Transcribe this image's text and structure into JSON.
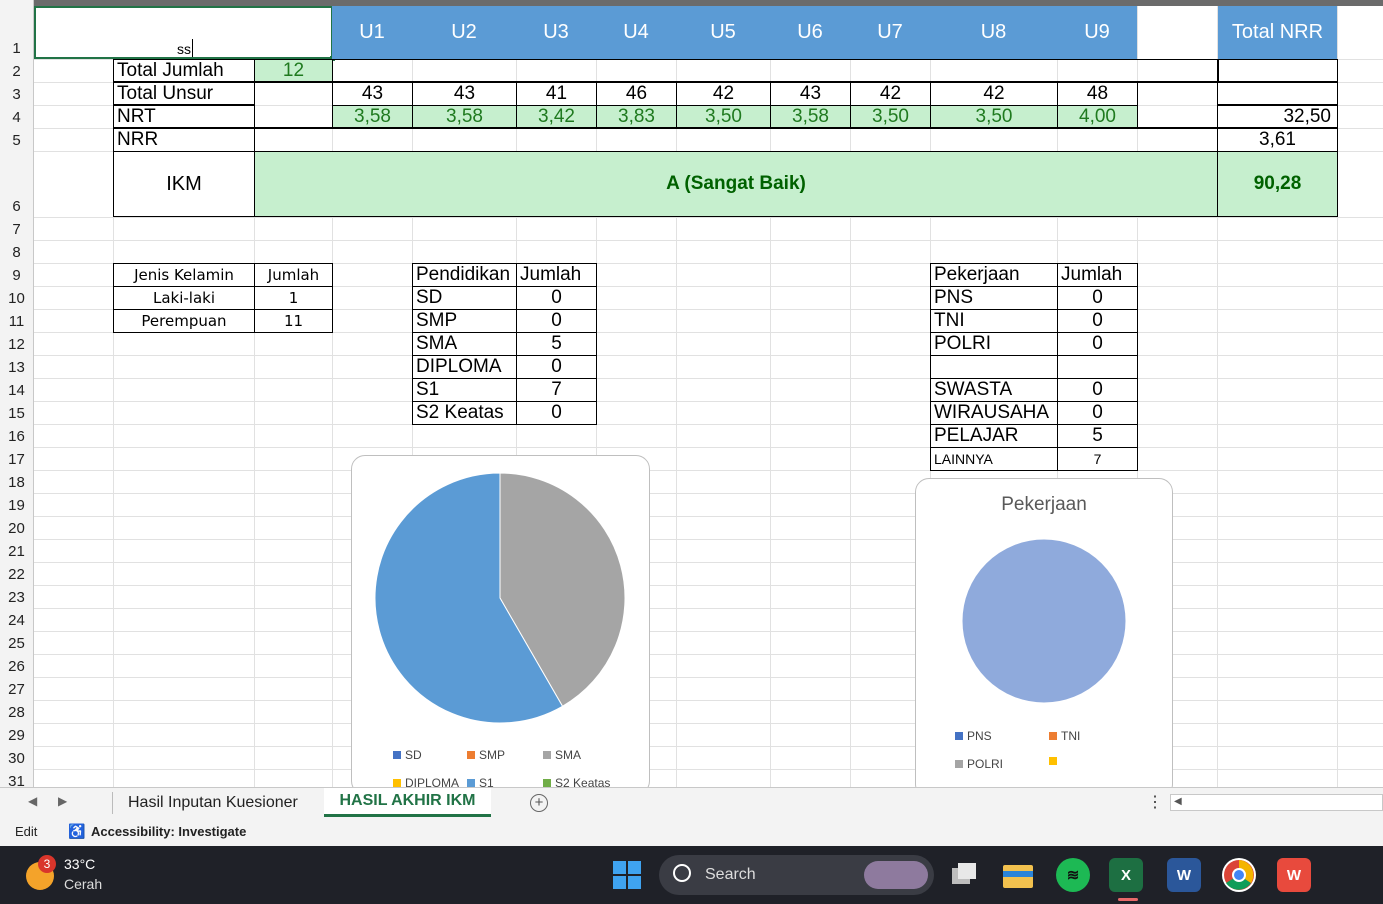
{
  "sheet": {
    "row_numbers": [
      "1",
      "2",
      "3",
      "4",
      "5",
      "6",
      "7",
      "8",
      "9",
      "10",
      "11",
      "12",
      "13",
      "14",
      "15",
      "16",
      "17",
      "18",
      "19",
      "20",
      "21",
      "22",
      "23",
      "24",
      "25",
      "26",
      "27",
      "28",
      "29",
      "30",
      "31"
    ],
    "active_cell_text": "ss",
    "unsur_headers": [
      "U1",
      "U2",
      "U3",
      "U4",
      "U5",
      "U6",
      "U7",
      "U8",
      "U9"
    ],
    "total_nrr_header": "Total NRR",
    "total_jumlah_label": "Total Jumlah",
    "total_jumlah_value": "12",
    "total_unsur_label": "Total Unsur",
    "total_unsur_values": [
      "43",
      "43",
      "41",
      "46",
      "42",
      "43",
      "42",
      "42",
      "48"
    ],
    "nrt_label": "NRT",
    "nrt_values": [
      "3,58",
      "3,58",
      "3,42",
      "3,83",
      "3,50",
      "3,58",
      "3,50",
      "3,50",
      "4,00"
    ],
    "nrt_total": "32,50",
    "nrr_label": "NRR",
    "nrr_total": "3,61",
    "ikm_label": "IKM",
    "ikm_grade": "A (Sangat Baik)",
    "ikm_value": "90,28",
    "gender_table": {
      "headers": [
        "Jenis Kelamin",
        "Jumlah"
      ],
      "rows": [
        [
          "Laki-laki",
          "1"
        ],
        [
          "Perempuan",
          "11"
        ]
      ]
    },
    "education_table": {
      "headers": [
        "Pendidikan",
        "Jumlah"
      ],
      "rows": [
        [
          "SD",
          "0"
        ],
        [
          "SMP",
          "0"
        ],
        [
          "SMA",
          "5"
        ],
        [
          "DIPLOMA",
          "0"
        ],
        [
          "S1",
          "7"
        ],
        [
          "S2 Keatas",
          "0"
        ]
      ]
    },
    "job_table": {
      "headers": [
        "Pekerjaan",
        "Jumlah"
      ],
      "rows": [
        [
          "PNS",
          "0"
        ],
        [
          "TNI",
          "0"
        ],
        [
          "POLRI",
          "0"
        ],
        [
          "",
          ""
        ],
        [
          "SWASTA",
          "0"
        ],
        [
          "WIRAUSAHA",
          "0"
        ],
        [
          "PELAJAR",
          "5"
        ],
        [
          "LAINNYA",
          "7"
        ]
      ]
    }
  },
  "chart_data": [
    {
      "type": "pie",
      "title": "",
      "categories": [
        "SD",
        "SMP",
        "SMA",
        "DIPLOMA",
        "S1",
        "S2 Keatas"
      ],
      "values": [
        0,
        0,
        5,
        0,
        7,
        0
      ],
      "colors": [
        "#4472c4",
        "#ed7d31",
        "#a5a5a5",
        "#ffc000",
        "#5b9bd5",
        "#70ad47"
      ]
    },
    {
      "type": "pie",
      "title": "Pekerjaan",
      "categories": [
        "PNS",
        "TNI",
        "POLRI",
        ""
      ],
      "values": [
        0,
        0,
        0,
        1
      ],
      "colors": [
        "#4472c4",
        "#ed7d31",
        "#a5a5a5",
        "#ffc000"
      ],
      "fill_color": "#8faadc"
    }
  ],
  "tabs": {
    "items": [
      "Hasil Inputan Kuesioner",
      "HASIL AKHIR IKM"
    ],
    "active": "HASIL AKHIR IKM",
    "active_color": "#217346"
  },
  "status": {
    "mode": "Edit",
    "accessibility": "Accessibility: Investigate"
  },
  "taskbar": {
    "weather_temp": "33°C",
    "weather_desc": "Cerah",
    "weather_badge": "3",
    "search_placeholder": "Search",
    "apps": [
      "windows-start-icon",
      "task-view-icon",
      "file-explorer-icon",
      "spotify-icon",
      "excel-icon",
      "word-icon",
      "chrome-icon",
      "wps-icon"
    ]
  }
}
